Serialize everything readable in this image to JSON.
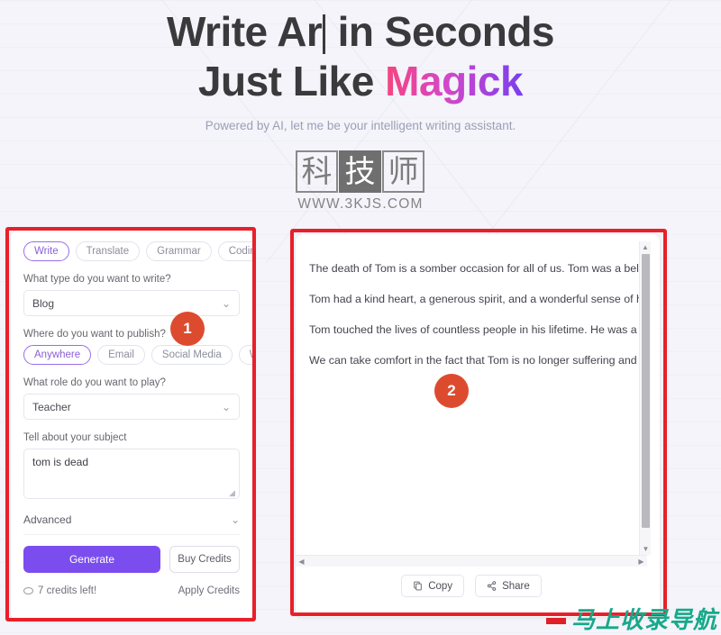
{
  "hero": {
    "headline_part1": "Write Ar",
    "headline_part2": " in Seconds",
    "headline_line2_prefix": "Just Like ",
    "headline_highlight": "Magick",
    "subtitle": "Powered by AI, let me be your intelligent writing assistant.",
    "highlight_gradient_from": "#f5457f",
    "highlight_gradient_to": "#7a3df0"
  },
  "logo": {
    "char1": "科",
    "char2": "技",
    "char3": "师",
    "url": "WWW.3KJS.COM"
  },
  "compose": {
    "mode_tabs": [
      {
        "label": "Write",
        "active": true
      },
      {
        "label": "Translate",
        "active": false
      },
      {
        "label": "Grammar",
        "active": false
      },
      {
        "label": "Coding",
        "active": false
      }
    ],
    "type_label": "What type do you want to write?",
    "type_value": "Blog",
    "publish_label": "Where do you want to publish?",
    "publish_options": [
      {
        "label": "Anywhere",
        "active": true
      },
      {
        "label": "Email",
        "active": false
      },
      {
        "label": "Social Media",
        "active": false
      },
      {
        "label": "Work",
        "active": false
      }
    ],
    "role_label": "What role do you want to play?",
    "role_value": "Teacher",
    "subject_label": "Tell about your subject",
    "subject_value": "tom is dead",
    "advanced_label": "Advanced",
    "generate_label": "Generate",
    "buy_credits_label": "Buy Credits",
    "credits_left": "7 credits left!",
    "apply_credits_label": "Apply Credits",
    "accent_color": "#7c4dee",
    "chevron": "⌄"
  },
  "output": {
    "paragraphs": [
      "The death of Tom is a somber occasion for all of us. Tom was a beloved member of the community and his passing is a tremendous loss.",
      "Tom had a kind heart, a generous spirit, and a wonderful sense of humor that brought joy to everyone he encountered. He was a great friend to many and was always willing to lend an ear and offer a comforting word. He was a loving father and grandfather and was always proud of his family.",
      "Tom touched the lives of countless people in his lifetime. He was a role model for many, and his kind and gentle nature will be deeply missed. He was a hard worker and was always willing to go the extra mile to help those in need. He was a mentor for many and his passing leaves a void in their lives.",
      "We can take comfort in the fact that Tom is no longer suffering and is now in a better place. We should take solace in the fact that he is no longer in pain and can now rest peacefully."
    ],
    "copy_label": "Copy",
    "share_label": "Share",
    "scroll_up_arrow": "▲",
    "scroll_down_arrow": "▼",
    "scroll_left_arrow": "◀",
    "scroll_right_arrow": "▶"
  },
  "annotations": {
    "badge_1": "1",
    "badge_2": "2",
    "box_color": "#e8202a",
    "badge_color": "#dd4b2f"
  },
  "watermark": {
    "text": "马上收录导航"
  }
}
